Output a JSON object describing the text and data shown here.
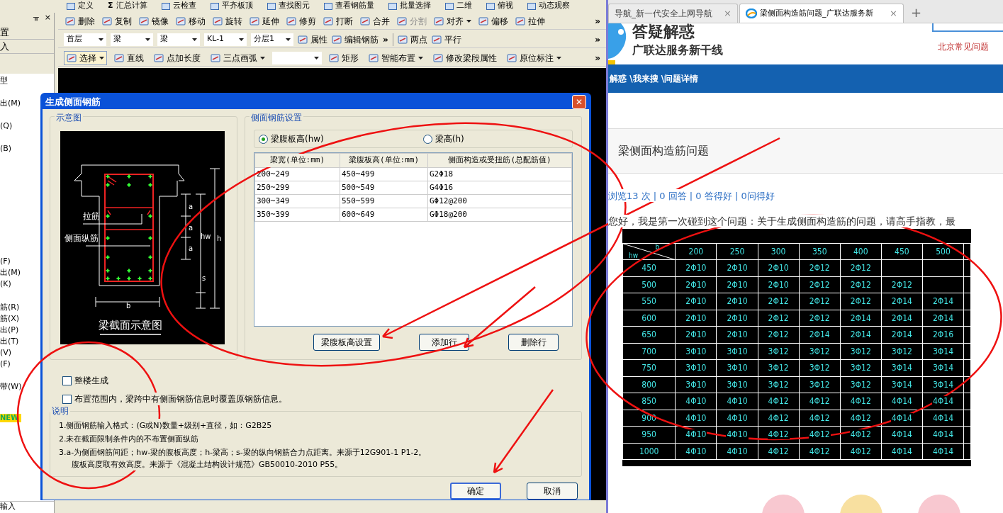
{
  "app": {
    "top_toolbar": [
      {
        "label": "定义"
      },
      {
        "label": "汇总计算",
        "glyph": "Σ"
      },
      {
        "label": "云检查"
      },
      {
        "label": "平齐板顶"
      },
      {
        "label": "查找图元"
      },
      {
        "label": "查看钢筋量"
      },
      {
        "label": "批量选择"
      },
      {
        "label": "二维"
      },
      {
        "label": "俯视"
      },
      {
        "label": "动态观察"
      }
    ],
    "side_panel": {
      "pin": "ᚂ",
      "close": "×",
      "tabs": [
        "置",
        "入"
      ],
      "items": [
        "型",
        "出(M)",
        "(Q)",
        "(B)",
        "(F)",
        "出(M)",
        "(K)",
        "筋(R)",
        "筋(X)",
        "出(P)",
        "出(T)",
        "(V)",
        "(F)",
        "带(W)"
      ],
      "badge": "NEW",
      "footer": "输入"
    },
    "edit_toolbar": [
      {
        "label": "删除",
        "disabled": false,
        "menu": false
      },
      {
        "label": "复制",
        "disabled": false,
        "menu": false
      },
      {
        "label": "镜像",
        "disabled": false,
        "menu": false
      },
      {
        "label": "移动",
        "disabled": false,
        "menu": false
      },
      {
        "label": "旋转",
        "disabled": false,
        "menu": false
      },
      {
        "label": "延伸",
        "disabled": false,
        "menu": false
      },
      {
        "label": "修剪",
        "disabled": false,
        "menu": false
      },
      {
        "label": "打断",
        "disabled": false,
        "menu": false
      },
      {
        "label": "合并",
        "disabled": false,
        "menu": false
      },
      {
        "label": "分割",
        "disabled": true,
        "menu": false
      },
      {
        "label": "对齐",
        "disabled": false,
        "menu": true
      },
      {
        "label": "偏移",
        "disabled": false,
        "menu": false
      },
      {
        "label": "拉伸",
        "disabled": false,
        "menu": false
      }
    ],
    "layer_selects": [
      "首层",
      "梁",
      "梁",
      "KL-1",
      "分层1"
    ],
    "layer_buttons": [
      "属性",
      "编辑钢筋"
    ],
    "snap_buttons": [
      "两点",
      "平行"
    ],
    "draw_toolbar": [
      {
        "label": "选择",
        "selected": true,
        "menu": true
      },
      {
        "label": "直线",
        "selected": false,
        "menu": false
      },
      {
        "label": "点加长度",
        "selected": false,
        "menu": false
      },
      {
        "label": "三点画弧",
        "selected": false,
        "menu": true
      },
      {
        "kind": "select"
      },
      {
        "label": "矩形",
        "selected": false,
        "menu": false
      },
      {
        "label": "智能布置",
        "selected": false,
        "menu": true
      },
      {
        "label": "修改梁段属性",
        "selected": false,
        "menu": false
      },
      {
        "label": "原位标注",
        "selected": false,
        "menu": true
      }
    ],
    "more": "»"
  },
  "dialog": {
    "title": "生成侧面钢筋",
    "close": "✕",
    "diagram_group": "示意图",
    "diagram": {
      "labels": [
        "拉筋",
        "侧面纵筋",
        "a",
        "a",
        "a",
        "hw",
        "h",
        "s",
        "b"
      ],
      "caption": "梁截面示意图"
    },
    "settings_group": "侧面钢筋设置",
    "radios": [
      {
        "label": "梁腹板高(hw)",
        "selected": true
      },
      {
        "label": "梁高(h)",
        "selected": false
      }
    ],
    "table": {
      "columns": [
        "梁宽(单位:mm)",
        "梁腹板高(单位:mm)",
        "侧面构造或受扭筋(总配筋值)"
      ],
      "rows": [
        [
          "200~249",
          "450~499",
          "G2Φ18"
        ],
        [
          "250~299",
          "500~549",
          "G4Φ16"
        ],
        [
          "300~349",
          "550~599",
          "GΦ12@200"
        ],
        [
          "350~399",
          "600~649",
          "GΦ18@200"
        ]
      ]
    },
    "table_buttons": [
      "梁腹板高设置",
      "添加行",
      "删除行"
    ],
    "checkboxes": [
      {
        "label": "整楼生成",
        "checked": false
      },
      {
        "label": "布置范围内，梁跨中有侧面钢筋信息时覆盖原钢筋信息。",
        "checked": false
      }
    ],
    "notes_title": "说明",
    "notes": [
      "1.侧面钢筋输入格式：(G或N)数量+级别+直径，如：G2B25",
      "2.未在截面限制条件内的不布置侧面纵筋",
      "3.a-为侧面钢筋间距；hw-梁的腹板高度；h-梁高；s-梁的纵向钢筋合力点距离。来源于12G901-1 P1-2。",
      "腹板高度取有效高度。来源于《混凝土结构设计规范》GB50010-2010 P55。"
    ],
    "buttons": [
      {
        "label": "确定",
        "default": true
      },
      {
        "label": "取消",
        "default": false
      }
    ]
  },
  "browser": {
    "tabs": [
      {
        "title": "导航_新一代安全上网导航",
        "selected": false,
        "close": "×"
      },
      {
        "title": "梁侧面构造筋问题_广联达服务新",
        "selected": true,
        "close": "×"
      }
    ],
    "new_tab": "+",
    "logo_title": "答疑解惑",
    "logo_subtitle": "广联达服务新干线",
    "header_link": "北京常见问题",
    "breadcrumb": "解惑 \\我来搜 \\问题详情",
    "question_title": "梁侧面构造筋问题",
    "stats": "浏览13 次 | 0 回答 | 0 答得好 | 0问得好",
    "body": "您好，我是第一次碰到这个问题：关于生成侧面构造筋的问题，请高手指教，最",
    "image_table": {
      "corner": [
        "hw",
        "b"
      ],
      "columns": [
        "200",
        "250",
        "300",
        "350",
        "400",
        "450",
        "500"
      ],
      "rows": [
        {
          "hw": "450",
          "cells": [
            "2Φ10",
            "2Φ10",
            "2Φ10",
            "2Φ12",
            "2Φ12",
            null,
            null
          ]
        },
        {
          "hw": "500",
          "cells": [
            "2Φ10",
            "2Φ10",
            "2Φ10",
            "2Φ12",
            "2Φ12",
            "2Φ12",
            null
          ]
        },
        {
          "hw": "550",
          "cells": [
            "2Φ10",
            "2Φ10",
            "2Φ12",
            "2Φ12",
            "2Φ12",
            "2Φ14",
            "2Φ14"
          ]
        },
        {
          "hw": "600",
          "cells": [
            "2Φ10",
            "2Φ10",
            "2Φ12",
            "2Φ12",
            "2Φ14",
            "2Φ14",
            "2Φ14"
          ]
        },
        {
          "hw": "650",
          "cells": [
            "2Φ10",
            "2Φ10",
            "2Φ12",
            "2Φ14",
            "2Φ14",
            "2Φ14",
            "2Φ16"
          ]
        },
        {
          "hw": "700",
          "cells": [
            "3Φ10",
            "3Φ10",
            "3Φ12",
            "3Φ12",
            "3Φ12",
            "3Φ12",
            "3Φ14"
          ]
        },
        {
          "hw": "750",
          "cells": [
            "3Φ10",
            "3Φ10",
            "3Φ12",
            "3Φ12",
            "3Φ12",
            "3Φ14",
            "3Φ14"
          ]
        },
        {
          "hw": "800",
          "cells": [
            "3Φ10",
            "3Φ10",
            "3Φ12",
            "3Φ12",
            "3Φ12",
            "3Φ14",
            "3Φ14"
          ]
        },
        {
          "hw": "850",
          "cells": [
            "4Φ10",
            "4Φ10",
            "4Φ12",
            "4Φ12",
            "4Φ12",
            "4Φ14",
            "4Φ14"
          ]
        },
        {
          "hw": "900",
          "cells": [
            "4Φ10",
            "4Φ10",
            "4Φ12",
            "4Φ12",
            "4Φ12",
            "4Φ14",
            "4Φ14"
          ]
        },
        {
          "hw": "950",
          "cells": [
            "4Φ10",
            "4Φ10",
            "4Φ12",
            "4Φ12",
            "4Φ12",
            "4Φ14",
            "4Φ14"
          ]
        },
        {
          "hw": "1000",
          "cells": [
            "4Φ10",
            "4Φ10",
            "4Φ12",
            "4Φ12",
            "4Φ12",
            "4Φ14",
            "4Φ14"
          ]
        }
      ]
    }
  }
}
